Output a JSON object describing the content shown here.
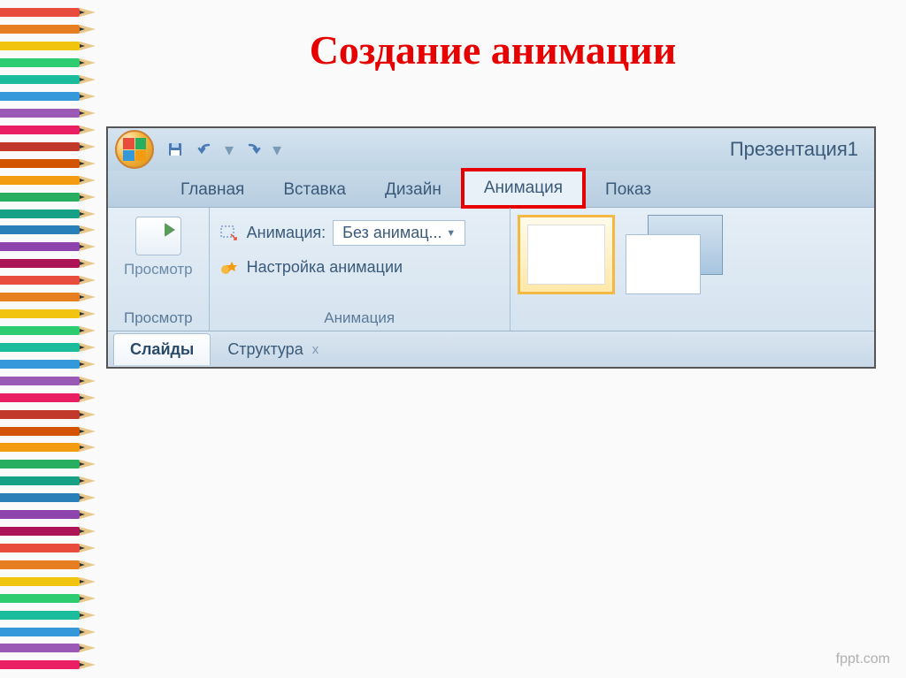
{
  "slide": {
    "title": "Создание анимации"
  },
  "app": {
    "doc_title": "Презентация1"
  },
  "tabs": {
    "home": "Главная",
    "insert": "Вставка",
    "design": "Дизайн",
    "animation": "Анимация",
    "slideshow": "Показ"
  },
  "ribbon": {
    "preview": {
      "button": "Просмотр",
      "group": "Просмотр"
    },
    "animation": {
      "label": "Анимация:",
      "value": "Без анимац...",
      "custom": "Настройка анимации",
      "group": "Анимация"
    }
  },
  "bottom_tabs": {
    "slides": "Слайды",
    "outline": "Структура",
    "close": "x"
  },
  "watermark": "fppt.com",
  "pencil_colors": [
    "#e74c3c",
    "#e67e22",
    "#f1c40f",
    "#2ecc71",
    "#1abc9c",
    "#3498db",
    "#9b59b6",
    "#e91e63",
    "#c0392b",
    "#d35400",
    "#f39c12",
    "#27ae60",
    "#16a085",
    "#2980b9",
    "#8e44ad",
    "#ad1457",
    "#e74c3c",
    "#e67e22",
    "#f1c40f",
    "#2ecc71",
    "#1abc9c",
    "#3498db",
    "#9b59b6",
    "#e91e63",
    "#c0392b",
    "#d35400",
    "#f39c12",
    "#27ae60",
    "#16a085",
    "#2980b9",
    "#8e44ad",
    "#ad1457",
    "#e74c3c",
    "#e67e22",
    "#f1c40f",
    "#2ecc71",
    "#1abc9c",
    "#3498db",
    "#9b59b6",
    "#e91e63"
  ]
}
